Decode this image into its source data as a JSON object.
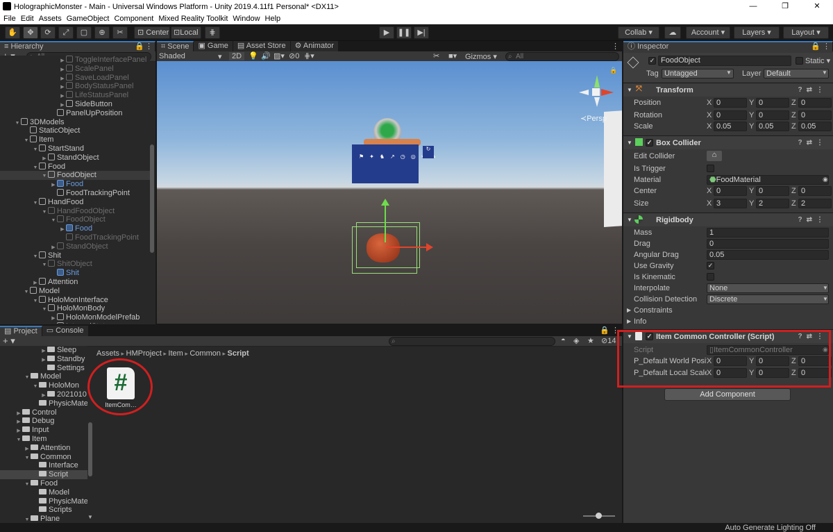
{
  "window": {
    "title": "HolographicMonster - Main - Universal Windows Platform - Unity 2019.4.11f1 Personal* <DX11>",
    "min": "—",
    "max": "❐",
    "close": "✕"
  },
  "menu": [
    "File",
    "Edit",
    "Assets",
    "GameObject",
    "Component",
    "Mixed Reality Toolkit",
    "Window",
    "Help"
  ],
  "toolbar": {
    "center": "Center",
    "local": "Local",
    "collab": "Collab ▾",
    "account": "Account ▾",
    "layers": "Layers ▾",
    "layout": "Layout ▾"
  },
  "hierarchy": {
    "tab": "Hierarchy",
    "search_placeholder": "All",
    "rows": [
      {
        "t": "ToggleInterfacePanel",
        "d": 7,
        "a": "▶",
        "s": "dim"
      },
      {
        "t": "ScalePanel",
        "d": 7,
        "a": "▶",
        "s": "dim"
      },
      {
        "t": "SaveLoadPanel",
        "d": 7,
        "a": "▶",
        "s": "dim"
      },
      {
        "t": "BodyStatusPanel",
        "d": 7,
        "a": "▶",
        "s": "dim"
      },
      {
        "t": "LifeStatusPanel",
        "d": 7,
        "a": "▶",
        "s": "dim"
      },
      {
        "t": "SideButton",
        "d": 7,
        "a": "▶",
        "s": ""
      },
      {
        "t": "PanelUpPosition",
        "d": 6,
        "a": "",
        "s": ""
      },
      {
        "t": "3DModels",
        "d": 2,
        "a": "▼",
        "s": ""
      },
      {
        "t": "StaticObject",
        "d": 3,
        "a": "",
        "s": ""
      },
      {
        "t": "Item",
        "d": 3,
        "a": "▼",
        "s": ""
      },
      {
        "t": "StartStand",
        "d": 4,
        "a": "▼",
        "s": ""
      },
      {
        "t": "StandObject",
        "d": 5,
        "a": "▶",
        "s": ""
      },
      {
        "t": "Food",
        "d": 4,
        "a": "▼",
        "s": ""
      },
      {
        "t": "FoodObject",
        "d": 5,
        "a": "▼",
        "s": "sel"
      },
      {
        "t": "Food",
        "d": 6,
        "a": "▶",
        "s": "blue"
      },
      {
        "t": "FoodTrackingPoint",
        "d": 6,
        "a": "",
        "s": ""
      },
      {
        "t": "HandFood",
        "d": 4,
        "a": "▼",
        "s": ""
      },
      {
        "t": "HandFoodObject",
        "d": 5,
        "a": "▼",
        "s": "dim"
      },
      {
        "t": "FoodObject",
        "d": 6,
        "a": "▼",
        "s": "dim"
      },
      {
        "t": "Food",
        "d": 7,
        "a": "▶",
        "s": "blue"
      },
      {
        "t": "FoodTrackingPoint",
        "d": 7,
        "a": "",
        "s": "dim"
      },
      {
        "t": "StandObject",
        "d": 6,
        "a": "▶",
        "s": "dim"
      },
      {
        "t": "Shit",
        "d": 4,
        "a": "▼",
        "s": ""
      },
      {
        "t": "ShitObject",
        "d": 5,
        "a": "▼",
        "s": "dim"
      },
      {
        "t": "Shit",
        "d": 6,
        "a": "",
        "s": "blue"
      },
      {
        "t": "Attention",
        "d": 4,
        "a": "▶",
        "s": ""
      },
      {
        "t": "Model",
        "d": 3,
        "a": "▼",
        "s": ""
      },
      {
        "t": "HoloMonInterface",
        "d": 4,
        "a": "▼",
        "s": ""
      },
      {
        "t": "HoloMonBody",
        "d": 5,
        "a": "▼",
        "s": ""
      },
      {
        "t": "HoloMonModelPrefab",
        "d": 6,
        "a": "▶",
        "s": ""
      },
      {
        "t": "InternalStatus",
        "d": 6,
        "a": "▶",
        "s": ""
      }
    ]
  },
  "scene": {
    "tabs": [
      "Scene",
      "Game",
      "Asset Store",
      "Animator"
    ],
    "shading": "Shaded",
    "twod": "2D",
    "gizmos": "Gizmos ▾",
    "search_placeholder": "All",
    "persp": "≺Persp",
    "fx": "0"
  },
  "inspector": {
    "tab": "Inspector",
    "object_name": "FoodObject",
    "static": "Static ▾",
    "tag_label": "Tag",
    "tag": "Untagged",
    "layer_label": "Layer",
    "layer": "Default",
    "transform": {
      "name": "Transform",
      "rows": [
        {
          "label": "Position",
          "x": "0",
          "y": "0",
          "z": "0"
        },
        {
          "label": "Rotation",
          "x": "0",
          "y": "0",
          "z": "0"
        },
        {
          "label": "Scale",
          "x": "0.05",
          "y": "0.05",
          "z": "0.05"
        }
      ]
    },
    "box": {
      "name": "Box Collider",
      "edit": "Edit Collider",
      "trigger": "Is Trigger",
      "material_label": "Material",
      "material": "FoodMaterial",
      "center": {
        "label": "Center",
        "x": "0",
        "y": "0",
        "z": "0"
      },
      "size": {
        "label": "Size",
        "x": "3",
        "y": "2",
        "z": "2"
      }
    },
    "rigidbody": {
      "name": "Rigidbody",
      "mass_l": "Mass",
      "mass": "1",
      "drag_l": "Drag",
      "drag": "0",
      "ang_l": "Angular Drag",
      "ang": "0.05",
      "grav": "Use Gravity",
      "kin": "Is Kinematic",
      "interp_l": "Interpolate",
      "interp": "None",
      "coll_l": "Collision Detection",
      "coll": "Discrete",
      "constraints": "Constraints",
      "info": "Info"
    },
    "script": {
      "name": "Item Common Controller (Script)",
      "script_l": "Script",
      "script": "ItemCommonController",
      "world": {
        "label": "P_Default World Positio",
        "x": "0",
        "y": "0",
        "z": "0"
      },
      "local": {
        "label": "P_Default Local Scale",
        "x": "0",
        "y": "0",
        "z": "0"
      }
    },
    "add_component": "Add Component"
  },
  "project": {
    "tabs": [
      "Project",
      "Console"
    ],
    "count": "14",
    "tree": [
      {
        "t": "Sleep",
        "d": 5,
        "a": "▶"
      },
      {
        "t": "Standby",
        "d": 5,
        "a": "▶"
      },
      {
        "t": "Settings",
        "d": 5,
        "a": ""
      },
      {
        "t": "Model",
        "d": 3,
        "a": "▼"
      },
      {
        "t": "HoloMon",
        "d": 4,
        "a": "▼"
      },
      {
        "t": "2021010",
        "d": 5,
        "a": "▶"
      },
      {
        "t": "PhysicMateria",
        "d": 4,
        "a": ""
      },
      {
        "t": "Control",
        "d": 2,
        "a": "▶"
      },
      {
        "t": "Debug",
        "d": 2,
        "a": "▶"
      },
      {
        "t": "Input",
        "d": 2,
        "a": "▶"
      },
      {
        "t": "Item",
        "d": 2,
        "a": "▼"
      },
      {
        "t": "Attention",
        "d": 3,
        "a": "▶"
      },
      {
        "t": "Common",
        "d": 3,
        "a": "▼"
      },
      {
        "t": "Interface",
        "d": 4,
        "a": ""
      },
      {
        "t": "Script",
        "d": 4,
        "a": "",
        "sel": true
      },
      {
        "t": "Food",
        "d": 3,
        "a": "▼"
      },
      {
        "t": "Model",
        "d": 4,
        "a": ""
      },
      {
        "t": "PhysicMate",
        "d": 4,
        "a": ""
      },
      {
        "t": "Scripts",
        "d": 4,
        "a": ""
      },
      {
        "t": "Plane",
        "d": 3,
        "a": "▼"
      }
    ],
    "breadcrumb": [
      "Assets",
      "HMProject",
      "Item",
      "Common",
      "Script"
    ],
    "asset_label": "ItemCom…",
    "asset_glyph": "#"
  },
  "status": "Auto Generate Lighting Off",
  "colors": {
    "accent": "#3a79bb",
    "highlight": "#d11f1f",
    "scene_panel": "#243c8c"
  }
}
